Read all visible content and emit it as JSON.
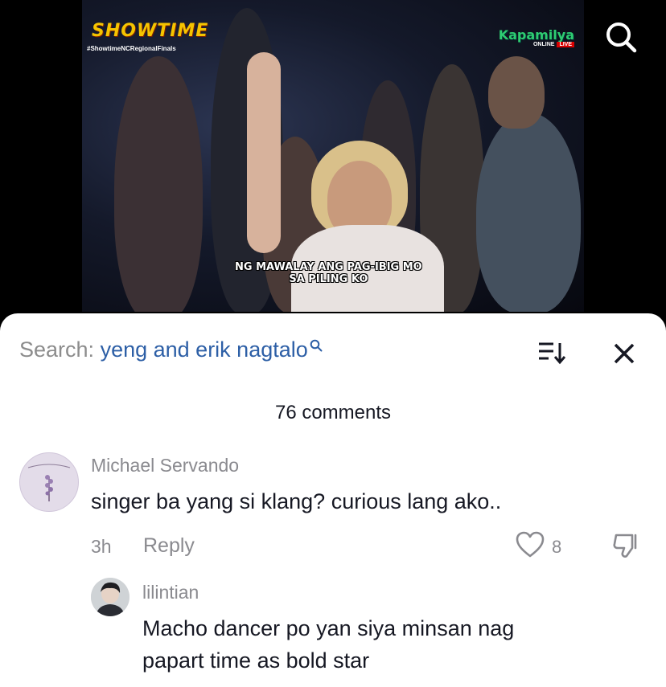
{
  "video": {
    "logo_left": "SHOWTIME",
    "hashtag": "#ShowtimeNCRegionalFinals",
    "logo_right": "Kapamilya",
    "online_label": "ONLINE",
    "live_label": "LIVE",
    "subtitle_line1": "NG MAWALAY ANG PAG-IBIG MO",
    "subtitle_line2": "SA PILING KO",
    "search_icon": "search-icon"
  },
  "search": {
    "label": "Search:",
    "query": "yeng and erik nagtalo"
  },
  "header": {
    "comment_count": "76 comments"
  },
  "comments": [
    {
      "author": "Michael Servando",
      "text": "singer ba yang si klang? curious lang ako..",
      "time": "3h",
      "reply_label": "Reply",
      "likes": "8",
      "replies": [
        {
          "author": "lilintian",
          "text_line1": "Macho dancer po yan siya minsan nag",
          "text_line2": "papart time as bold star"
        }
      ]
    }
  ],
  "colors": {
    "query": "#2d5fa6",
    "muted": "#8a8a8f",
    "text": "#161823"
  }
}
